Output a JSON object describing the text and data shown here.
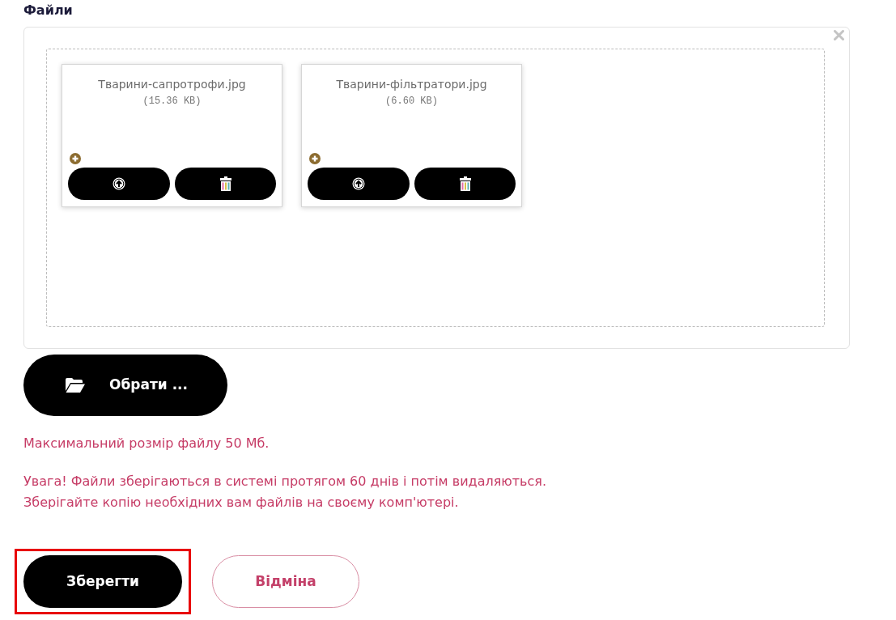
{
  "section": {
    "title": "Файли"
  },
  "files": [
    {
      "name": "Тварини-сапротрофи.jpg",
      "size": "(15.36 KB)"
    },
    {
      "name": "Тварини-фільтратори.jpg",
      "size": "(6.60 KB)"
    }
  ],
  "browse_button": {
    "label": "Обрати ..."
  },
  "notes": [
    "Максимальний розмір файлу 50 Мб.",
    "Увага! Файли зберігаються в системі протягом 60 днів і потім видаляються.\nЗберігайте копію необхідних вам файлів на своєму комп'ютері."
  ],
  "actions": [
    {
      "label": "Зберегти",
      "kind": "primary",
      "highlighted": true
    },
    {
      "label": "Відміна",
      "kind": "secondary",
      "highlighted": false
    }
  ]
}
